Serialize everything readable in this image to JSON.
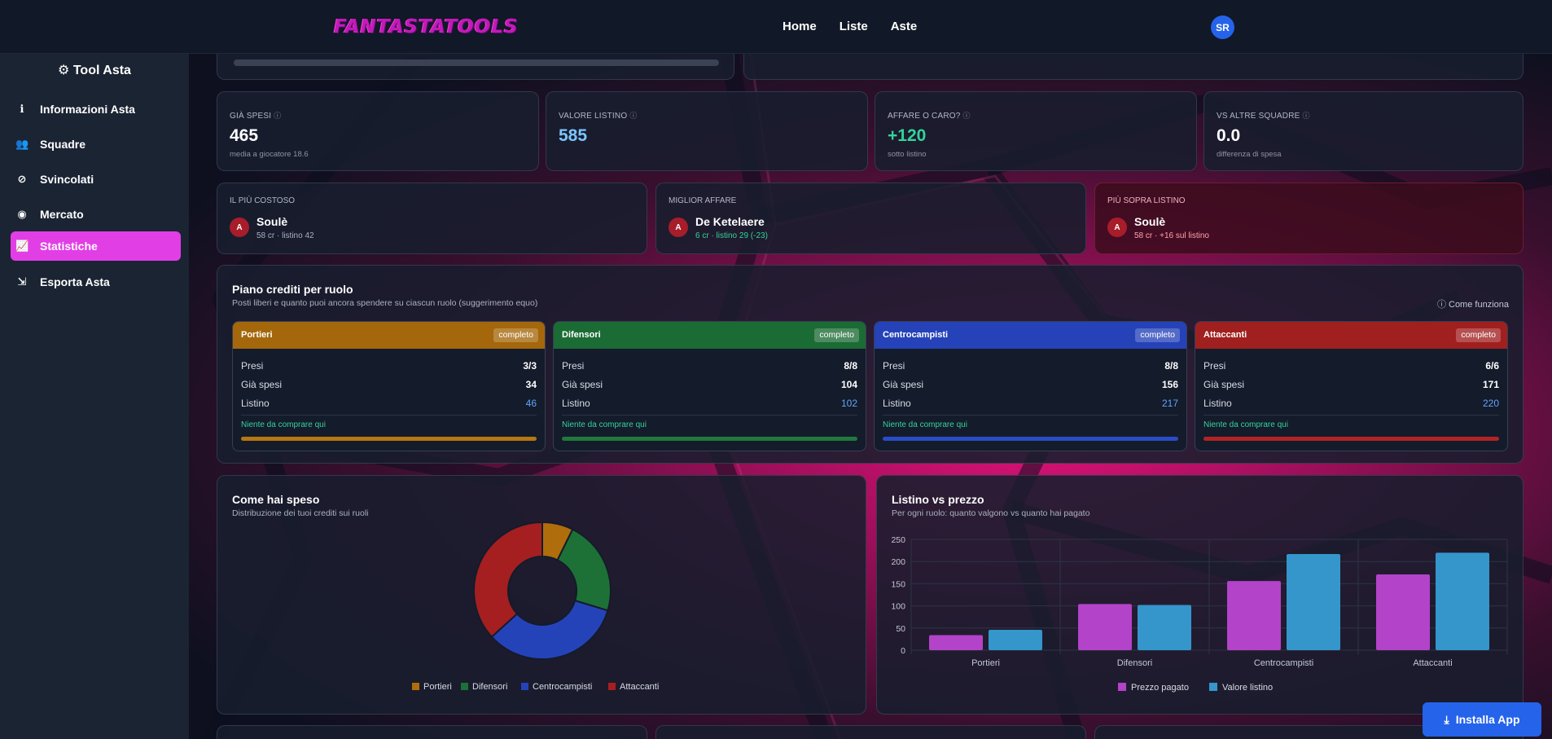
{
  "header": {
    "logo": "FANTASTATOOLS",
    "nav": [
      "Home",
      "Liste",
      "Aste"
    ],
    "avatar": "SR"
  },
  "sidebar": {
    "title": "Tool Asta",
    "items": [
      {
        "label": "Informazioni Asta",
        "icon": "info-icon"
      },
      {
        "label": "Squadre",
        "icon": "users-icon"
      },
      {
        "label": "Svincolati",
        "icon": "user-slash-icon"
      },
      {
        "label": "Mercato",
        "icon": "coins-icon"
      },
      {
        "label": "Statistiche",
        "icon": "chart-line-icon",
        "active": true
      },
      {
        "label": "Esporta Asta",
        "icon": "export-icon"
      }
    ]
  },
  "stats": [
    {
      "label": "GIÀ SPESI",
      "value": "465",
      "sub": "media a giocatore 18.6",
      "color": "#ffffff"
    },
    {
      "label": "VALORE LISTINO",
      "value": "585",
      "sub": "",
      "color": "#7cc4ff"
    },
    {
      "label": "AFFARE O CARO?",
      "value": "+120",
      "sub": "sotto listino",
      "color": "#34d399"
    },
    {
      "label": "VS ALTRE SQUADRE",
      "value": "0.0",
      "sub": "differenza di spesa",
      "color": "#ffffff"
    }
  ],
  "highlights": [
    {
      "label": "IL PIÙ COSTOSO",
      "badge": "A",
      "name": "Soulè",
      "sub": "58 cr · listino 42",
      "sub_color": "#aab1bf"
    },
    {
      "label": "MIGLIOR AFFARE",
      "badge": "A",
      "name": "De Ketelaere",
      "sub": "6 cr · listino 29 (-23)",
      "sub_color": "#34d399"
    },
    {
      "label": "PIÙ SOPRA LISTINO",
      "badge": "A",
      "name": "Soulè",
      "sub": "58 cr · +16 sul listino",
      "sub_color": "#fda4af"
    }
  ],
  "plan": {
    "title": "Piano crediti per ruolo",
    "subtitle": "Posti liberi e quanto puoi ancora spendere su ciascun ruolo (suggerimento equo)",
    "help": "Come funziona",
    "row_labels": [
      "Presi",
      "Già spesi",
      "Listino"
    ],
    "roles": [
      {
        "name": "Portieri",
        "status": "completo",
        "presi": "3/3",
        "spesi": "34",
        "listino": "46",
        "note": "Niente da comprare qui",
        "color": "#a5670b"
      },
      {
        "name": "Difensori",
        "status": "completo",
        "presi": "8/8",
        "spesi": "104",
        "listino": "102",
        "note": "Niente da comprare qui",
        "color": "#1b6b35"
      },
      {
        "name": "Centrocampisti",
        "status": "completo",
        "presi": "8/8",
        "spesi": "156",
        "listino": "217",
        "note": "Niente da comprare qui",
        "color": "#2542b8"
      },
      {
        "name": "Attaccanti",
        "status": "completo",
        "presi": "6/6",
        "spesi": "171",
        "listino": "220",
        "note": "Niente da comprare qui",
        "color": "#a0201f"
      }
    ]
  },
  "spend": {
    "title": "Come hai speso",
    "subtitle": "Distribuzione dei tuoi crediti sui ruoli"
  },
  "compare": {
    "title": "Listino vs prezzo",
    "subtitle": "Per ogni ruolo: quanto valgono vs quanto hai pagato"
  },
  "chart_data": [
    {
      "type": "pie",
      "categories": [
        "Portieri",
        "Difensori",
        "Centrocampisti",
        "Attaccanti"
      ],
      "values": [
        34,
        104,
        156,
        171
      ],
      "colors": [
        "#b06d0c",
        "#1d7136",
        "#2543b9",
        "#a51f20"
      ],
      "legend": "bottom"
    },
    {
      "type": "bar",
      "categories": [
        "Portieri",
        "Difensori",
        "Centrocampisti",
        "Attaccanti"
      ],
      "series": [
        {
          "name": "Prezzo pagato",
          "values": [
            34,
            104,
            156,
            171
          ],
          "color": "#b343c9"
        },
        {
          "name": "Valore listino",
          "values": [
            46,
            102,
            217,
            220
          ],
          "color": "#3596cb"
        }
      ],
      "ylim": [
        0,
        250
      ],
      "yticks": [
        "0",
        "50",
        "100",
        "150",
        "200",
        "250"
      ],
      "grid": true,
      "legend": "bottom"
    }
  ],
  "install": {
    "label": "Installa App"
  }
}
